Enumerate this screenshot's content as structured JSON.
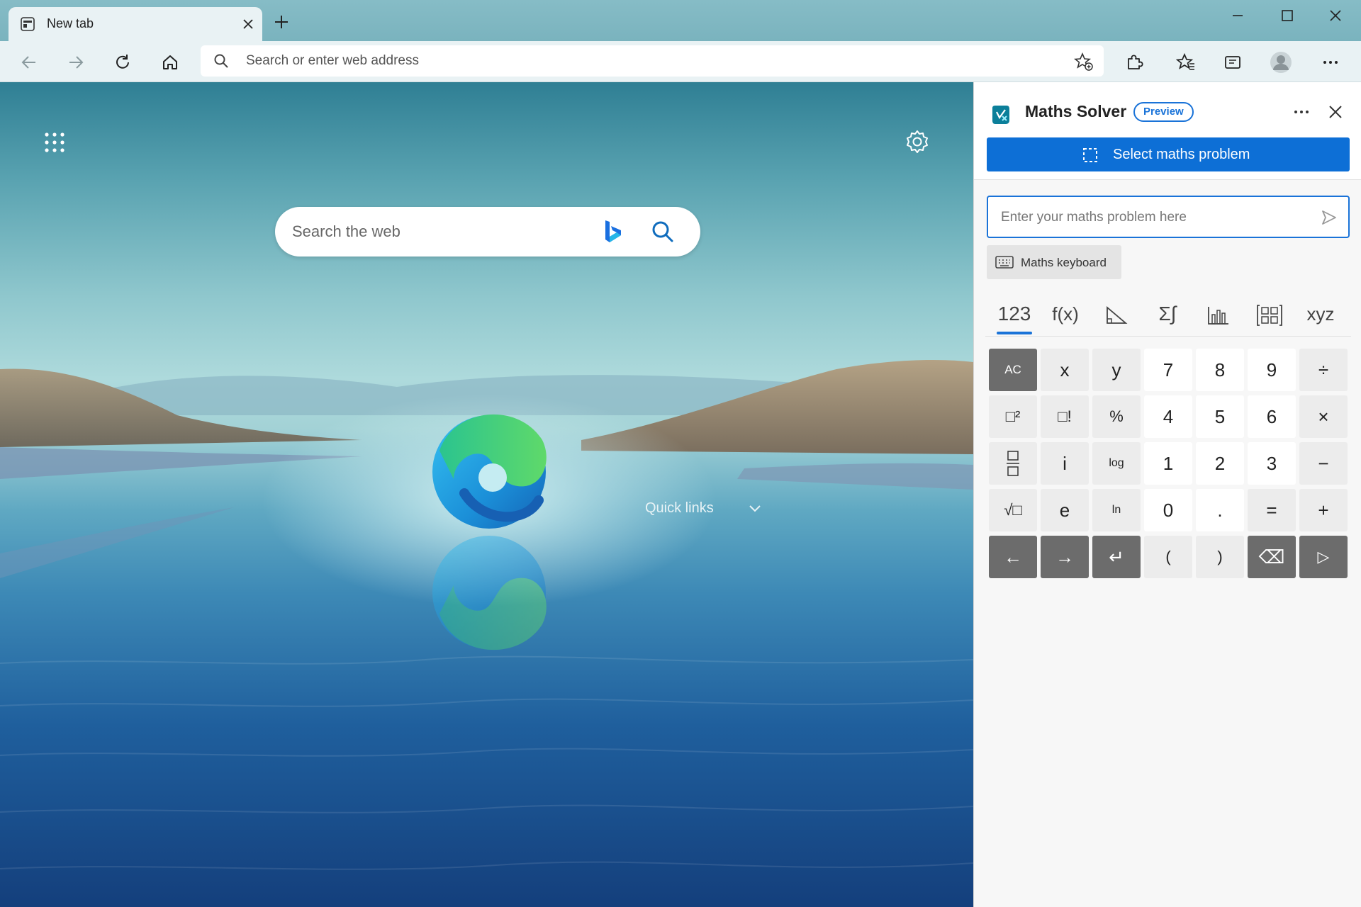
{
  "browser": {
    "tab_title": "New tab",
    "address_placeholder": "Search or enter web address"
  },
  "ntp": {
    "search_placeholder": "Search the web",
    "quick_links_label": "Quick links"
  },
  "maths_solver": {
    "title": "Maths Solver",
    "badge": "Preview",
    "select_button": "Select maths problem",
    "input_placeholder": "Enter your maths problem here",
    "keyboard_button": "Maths keyboard",
    "categories": [
      {
        "label": "123",
        "active": true
      },
      {
        "label": "f(x)",
        "active": false
      },
      {
        "label": "",
        "icon": "geometry-icon",
        "active": false
      },
      {
        "label": "Σ∫",
        "active": false
      },
      {
        "label": "",
        "icon": "statistics-icon",
        "active": false
      },
      {
        "label": "",
        "icon": "matrix-icon",
        "active": false
      },
      {
        "label": "xyz",
        "active": false
      }
    ],
    "keypad_rows": [
      [
        "AC",
        "x",
        "y",
        "7",
        "8",
        "9",
        "÷"
      ],
      [
        "□²",
        "□!",
        "%",
        "4",
        "5",
        "6",
        "×"
      ],
      [
        "fraction",
        "i",
        "log",
        "1",
        "2",
        "3",
        "−"
      ],
      [
        "√□",
        "e",
        "ln",
        "0",
        ".",
        "=",
        "+"
      ],
      [
        "←",
        "→",
        "↵",
        "(",
        ")",
        "⌫",
        "▷"
      ]
    ]
  },
  "colors": {
    "accent": "#1a73d8",
    "select_button": "#0d6fd6",
    "dark_key": "#6c6c6c"
  }
}
